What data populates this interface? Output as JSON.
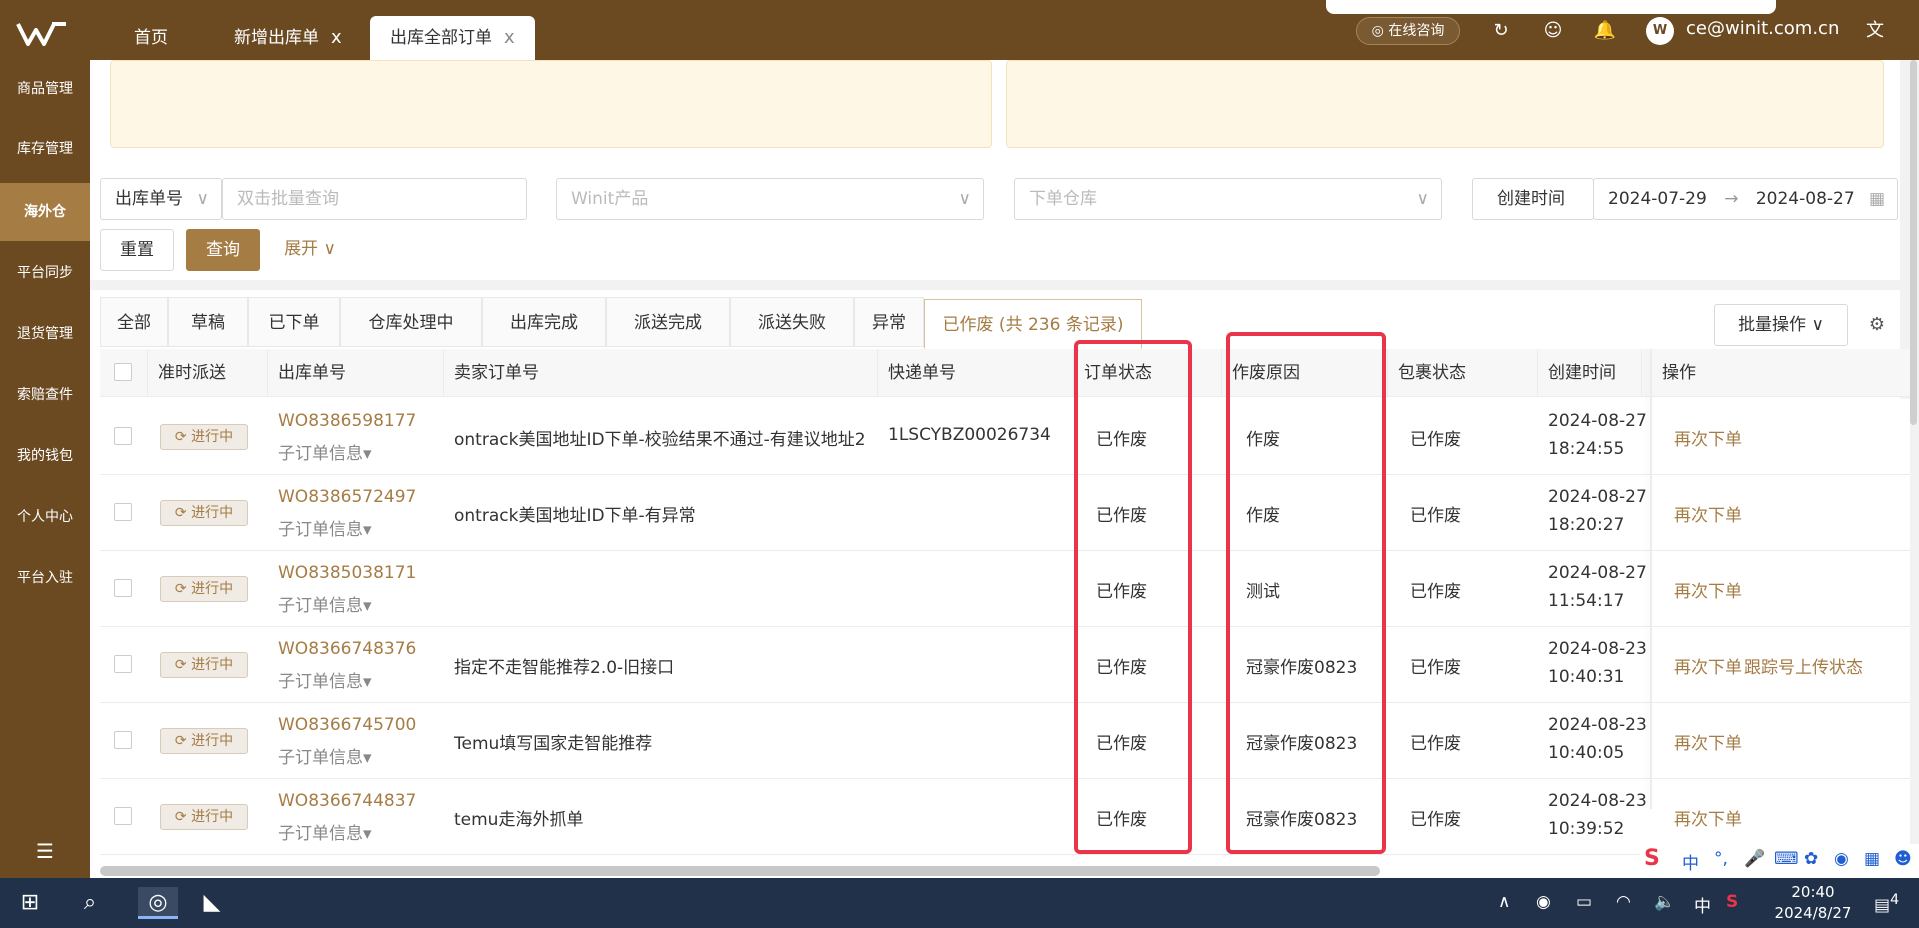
{
  "sidebar": {
    "items": [
      {
        "label": "商品管理"
      },
      {
        "label": "库存管理"
      },
      {
        "label": "海外仓"
      },
      {
        "label": "平台同步"
      },
      {
        "label": "退货管理"
      },
      {
        "label": "索赔查件"
      },
      {
        "label": "我的钱包"
      },
      {
        "label": "个人中心"
      },
      {
        "label": "平台入驻"
      }
    ],
    "active": "海外仓"
  },
  "tabs": [
    {
      "label": "首页"
    },
    {
      "label": "新增出库单"
    },
    {
      "label": "出库全部订单"
    }
  ],
  "close_glyph": "x",
  "header": {
    "consult_label": "在线咨询",
    "user_email": "ce@winit.com.cn"
  },
  "filters": {
    "order_type": "出库单号",
    "query_placeholder": "双击批量查询",
    "product_placeholder": "Winit产品",
    "warehouse_placeholder": "下单仓库",
    "date_type": "创建时间",
    "date_start": "2024-07-29",
    "date_sep": "→",
    "date_end": "2024-08-27",
    "reset_label": "重置",
    "search_label": "查询",
    "expand_label": "展开"
  },
  "status_tabs": [
    {
      "label": "全部"
    },
    {
      "label": "草稿"
    },
    {
      "label": "已下单"
    },
    {
      "label": "仓库处理中"
    },
    {
      "label": "出库完成"
    },
    {
      "label": "派送完成"
    },
    {
      "label": "派送失败"
    },
    {
      "label": "异常"
    },
    {
      "label": "已作废 (共 236 条记录)"
    }
  ],
  "batch_label": "批量操作",
  "table": {
    "headers": [
      "准时派送",
      "出库单号",
      "卖家订单号",
      "快递单号",
      "订单状态",
      "作废原因",
      "包裹状态",
      "创建时间",
      "操作"
    ],
    "rows": [
      {
        "badge": "进行中",
        "order_no": "WO8386598177",
        "sub": "子订单信息",
        "seller_no": "ontrack美国地址ID下单-校验结果不通过-有建议地址2",
        "tracking": "1LSCYBZ00026734",
        "status": "已作废",
        "reason": "作废",
        "package": "已作废",
        "date": "2024-08-27",
        "time": "18:24:55",
        "op1": "再次下单",
        "op2": ""
      },
      {
        "badge": "进行中",
        "order_no": "WO8386572497",
        "sub": "子订单信息",
        "seller_no": "ontrack美国地址ID下单-有异常",
        "tracking": "",
        "status": "已作废",
        "reason": "作废",
        "package": "已作废",
        "date": "2024-08-27",
        "time": "18:20:27",
        "op1": "再次下单",
        "op2": ""
      },
      {
        "badge": "进行中",
        "order_no": "WO8385038171",
        "sub": "子订单信息",
        "seller_no": "",
        "tracking": "",
        "status": "已作废",
        "reason": "测试",
        "package": "已作废",
        "date": "2024-08-27",
        "time": "11:54:17",
        "op1": "再次下单",
        "op2": ""
      },
      {
        "badge": "进行中",
        "order_no": "WO8366748376",
        "sub": "子订单信息",
        "seller_no": "指定不走智能推荐2.0-旧接口",
        "tracking": "",
        "status": "已作废",
        "reason": "冠豪作废0823",
        "package": "已作废",
        "date": "2024-08-23",
        "time": "10:40:31",
        "op1": "再次下单",
        "op2": "跟踪号上传状态"
      },
      {
        "badge": "进行中",
        "order_no": "WO8366745700",
        "sub": "子订单信息",
        "seller_no": "Temu填写国家走智能推荐",
        "tracking": "",
        "status": "已作废",
        "reason": "冠豪作废0823",
        "package": "已作废",
        "date": "2024-08-23",
        "time": "10:40:05",
        "op1": "再次下单",
        "op2": ""
      },
      {
        "badge": "进行中",
        "order_no": "WO8366744837",
        "sub": "子订单信息",
        "seller_no": "temu走海外抓单",
        "tracking": "",
        "status": "已作废",
        "reason": "冠豪作废0823",
        "package": "已作废",
        "date": "2024-08-23",
        "time": "10:39:52",
        "op1": "再次下单",
        "op2": ""
      }
    ]
  },
  "ime": {
    "lang": "中"
  },
  "taskbar": {
    "time": "20:40",
    "date": "2024/8/27",
    "lang": "中",
    "notifications": "4"
  },
  "colors": {
    "brand": "#6b4a22",
    "accent": "#a67c45",
    "highlight": "#e8354a"
  }
}
